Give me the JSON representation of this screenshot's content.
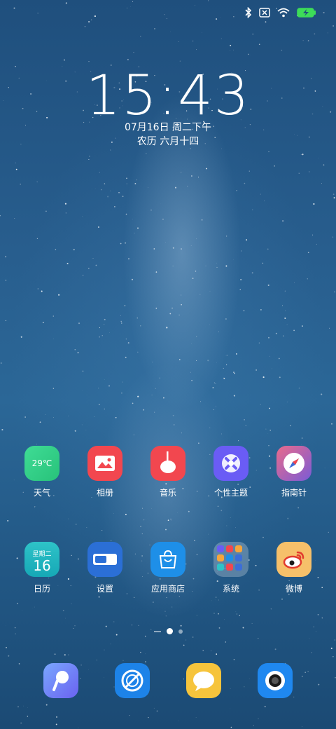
{
  "status_bar": {
    "icons": [
      "bluetooth-icon",
      "sim-x-icon",
      "wifi-icon",
      "battery-charging-icon"
    ],
    "battery_color": "#3ddc58"
  },
  "lockscreen": {
    "time": "15:43",
    "date": "07月16日 周二下午",
    "lunar": "农历 六月十四"
  },
  "apps_row1": [
    {
      "label": "天气",
      "icon": "weather-icon",
      "badge_text": "29℃"
    },
    {
      "label": "相册",
      "icon": "gallery-icon"
    },
    {
      "label": "音乐",
      "icon": "music-icon"
    },
    {
      "label": "个性主题",
      "icon": "theme-icon"
    },
    {
      "label": "指南针",
      "icon": "compass-icon"
    }
  ],
  "apps_row2": [
    {
      "label": "日历",
      "icon": "calendar-icon",
      "weekday": "星期二",
      "day": "16"
    },
    {
      "label": "设置",
      "icon": "settings-icon"
    },
    {
      "label": "应用商店",
      "icon": "app-store-icon"
    },
    {
      "label": "系统",
      "icon": "folder-icon"
    },
    {
      "label": "微博",
      "icon": "weibo-icon"
    }
  ],
  "page_indicator": {
    "pages": 2,
    "current": 1
  },
  "dock": [
    {
      "icon": "phone-icon"
    },
    {
      "icon": "browser-icon"
    },
    {
      "icon": "messages-icon"
    },
    {
      "icon": "camera-icon"
    }
  ]
}
